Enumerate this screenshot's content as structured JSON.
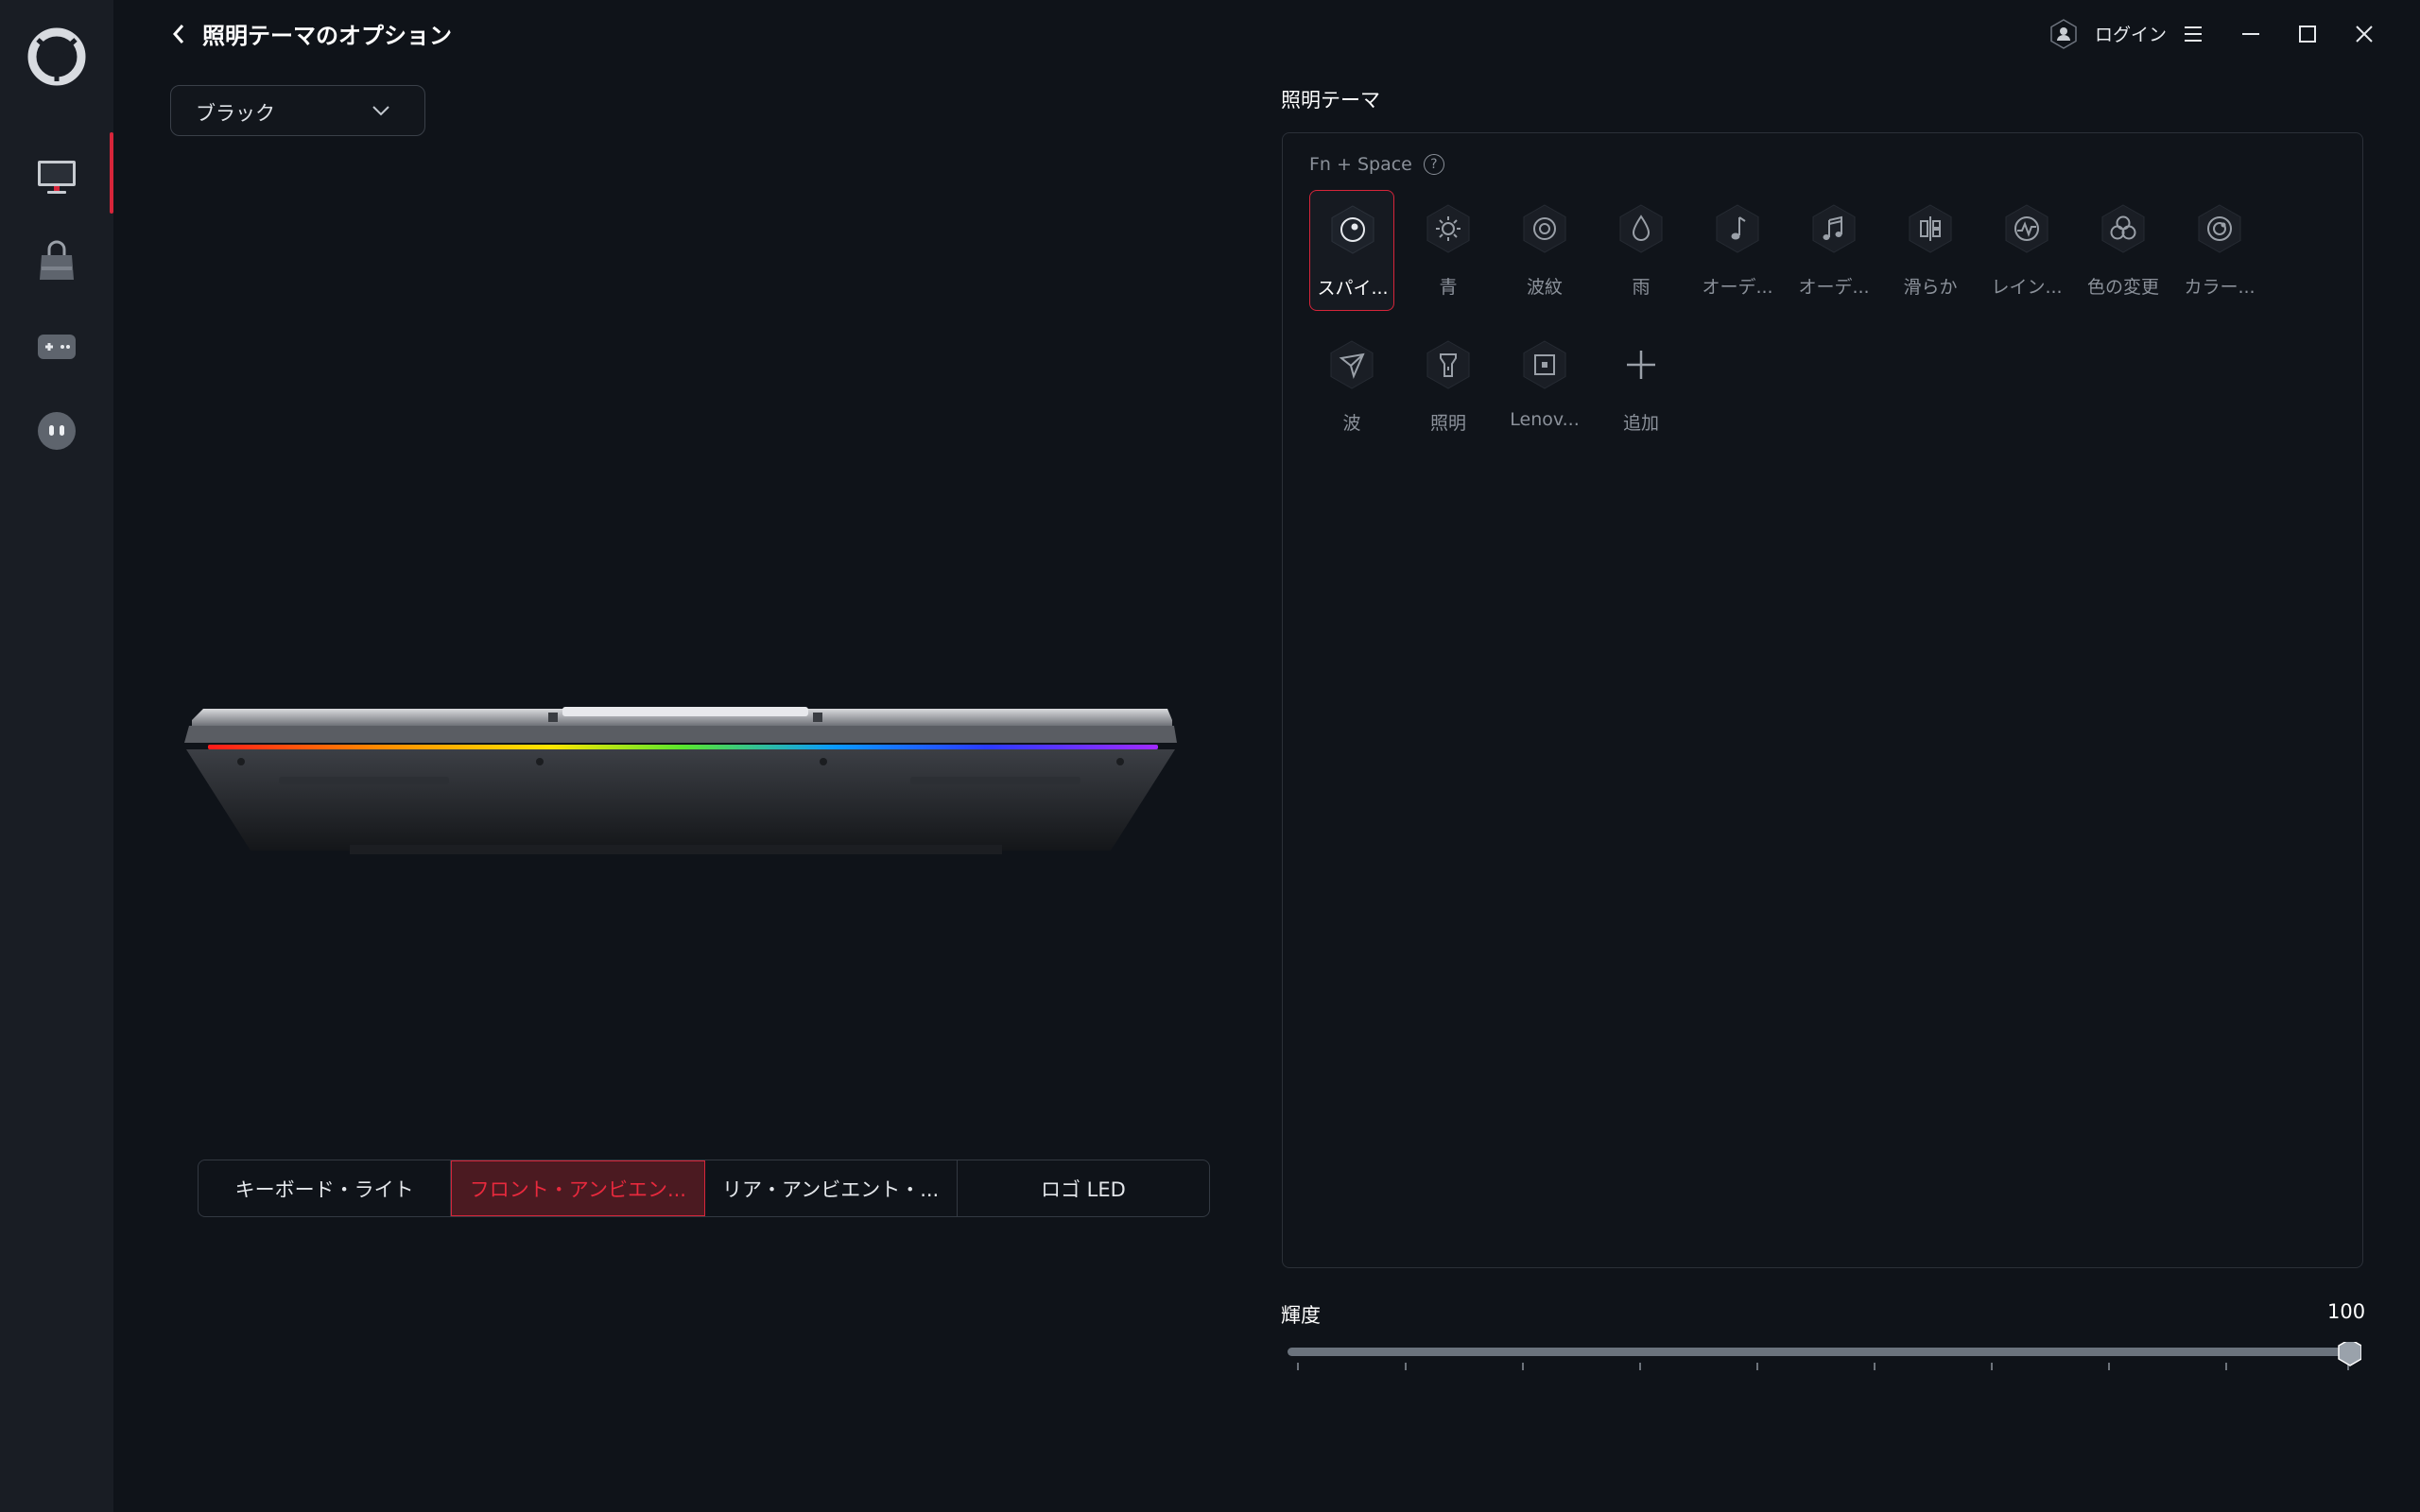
{
  "header": {
    "title": "照明テーマのオプション",
    "login_label": "ログイン"
  },
  "sidebar": {
    "items": [
      {
        "name": "device",
        "active": true
      },
      {
        "name": "store",
        "active": false
      },
      {
        "name": "game",
        "active": false
      },
      {
        "name": "assistant",
        "active": false
      }
    ]
  },
  "color_select": {
    "value": "ブラック"
  },
  "zone_tabs": [
    {
      "label": "キーボード・ライト",
      "active": false
    },
    {
      "label": "フロント・アンビエン...",
      "active": true
    },
    {
      "label": "リア・アンビエント・...",
      "active": false
    },
    {
      "label": "ロゴ LED",
      "active": false
    }
  ],
  "themes": {
    "section_title": "照明テーマ",
    "shortcut": "Fn + Space",
    "help_glyph": "?",
    "items": [
      {
        "label": "スパイ...",
        "icon": "palette-icon",
        "selected": true
      },
      {
        "label": "青",
        "icon": "sun-icon",
        "selected": false
      },
      {
        "label": "波紋",
        "icon": "ripple-icon",
        "selected": false
      },
      {
        "label": "雨",
        "icon": "raindrop-icon",
        "selected": false
      },
      {
        "label": "オーデ...",
        "icon": "music-note-icon",
        "selected": false
      },
      {
        "label": "オーデ...",
        "icon": "music-notes-icon",
        "selected": false
      },
      {
        "label": "滑らか",
        "icon": "smooth-icon",
        "selected": false
      },
      {
        "label": "レイン...",
        "icon": "rainbow-icon",
        "selected": false
      },
      {
        "label": "色の変更",
        "icon": "color-cycle-icon",
        "selected": false
      },
      {
        "label": "カラー...",
        "icon": "color-wave-icon",
        "selected": false
      },
      {
        "label": "波",
        "icon": "wave-icon",
        "selected": false
      },
      {
        "label": "照明",
        "icon": "flashlight-icon",
        "selected": false
      },
      {
        "label": "Lenov...",
        "icon": "lenovo-icon",
        "selected": false
      },
      {
        "label": "追加",
        "icon": "plus-icon",
        "selected": false
      }
    ]
  },
  "brightness": {
    "label": "輝度",
    "value": "100",
    "level": 1.0
  },
  "colors": {
    "accent": "#d6253a",
    "background": "#0f1319",
    "sidebar": "#191d24"
  }
}
